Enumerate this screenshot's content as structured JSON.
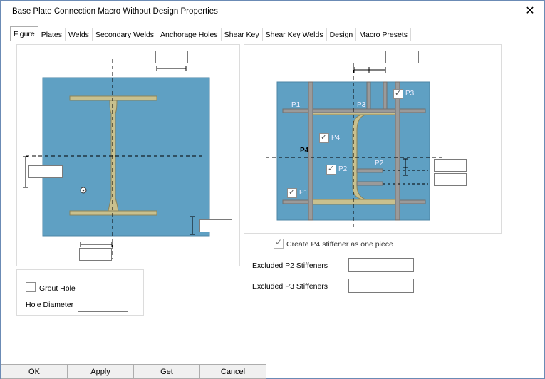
{
  "window": {
    "title": "Base Plate Connection Macro Without Design Properties",
    "close_glyph": "✕"
  },
  "tabs": [
    {
      "label": "Figure",
      "active": true
    },
    {
      "label": "Plates"
    },
    {
      "label": "Welds"
    },
    {
      "label": "Secondary Welds"
    },
    {
      "label": "Anchorage Holes"
    },
    {
      "label": "Shear Key"
    },
    {
      "label": "Shear Key Welds"
    },
    {
      "label": "Design"
    },
    {
      "label": "Macro Presets"
    }
  ],
  "right_figure": {
    "labels": {
      "p1": "P1",
      "p2": "P2",
      "p3": "P3",
      "p4": "P4"
    },
    "checkboxes": {
      "p1": {
        "label": "P1",
        "checked": true
      },
      "p2": {
        "label": "P2",
        "checked": true
      },
      "p3": {
        "label": "P3",
        "checked": true
      },
      "p4": {
        "label": "P4",
        "checked": true
      }
    }
  },
  "create_p4": {
    "label": "Create P4 stiffener as one piece",
    "checked": true
  },
  "excluded_p2": {
    "label": "Excluded P2 Stiffeners",
    "value": ""
  },
  "excluded_p3": {
    "label": "Excluded P3 Stiffeners",
    "value": ""
  },
  "grout_hole": {
    "label": "Grout Hole",
    "checked": false
  },
  "hole_diameter": {
    "label": "Hole Diameter",
    "value": ""
  },
  "buttons": {
    "ok": "OK",
    "apply": "Apply",
    "get": "Get",
    "cancel": "Cancel"
  },
  "colors": {
    "plate": "#5fa0c3",
    "steel": "#c8c08e",
    "stiffener": "#9a9a9a",
    "dim": "#000000"
  }
}
